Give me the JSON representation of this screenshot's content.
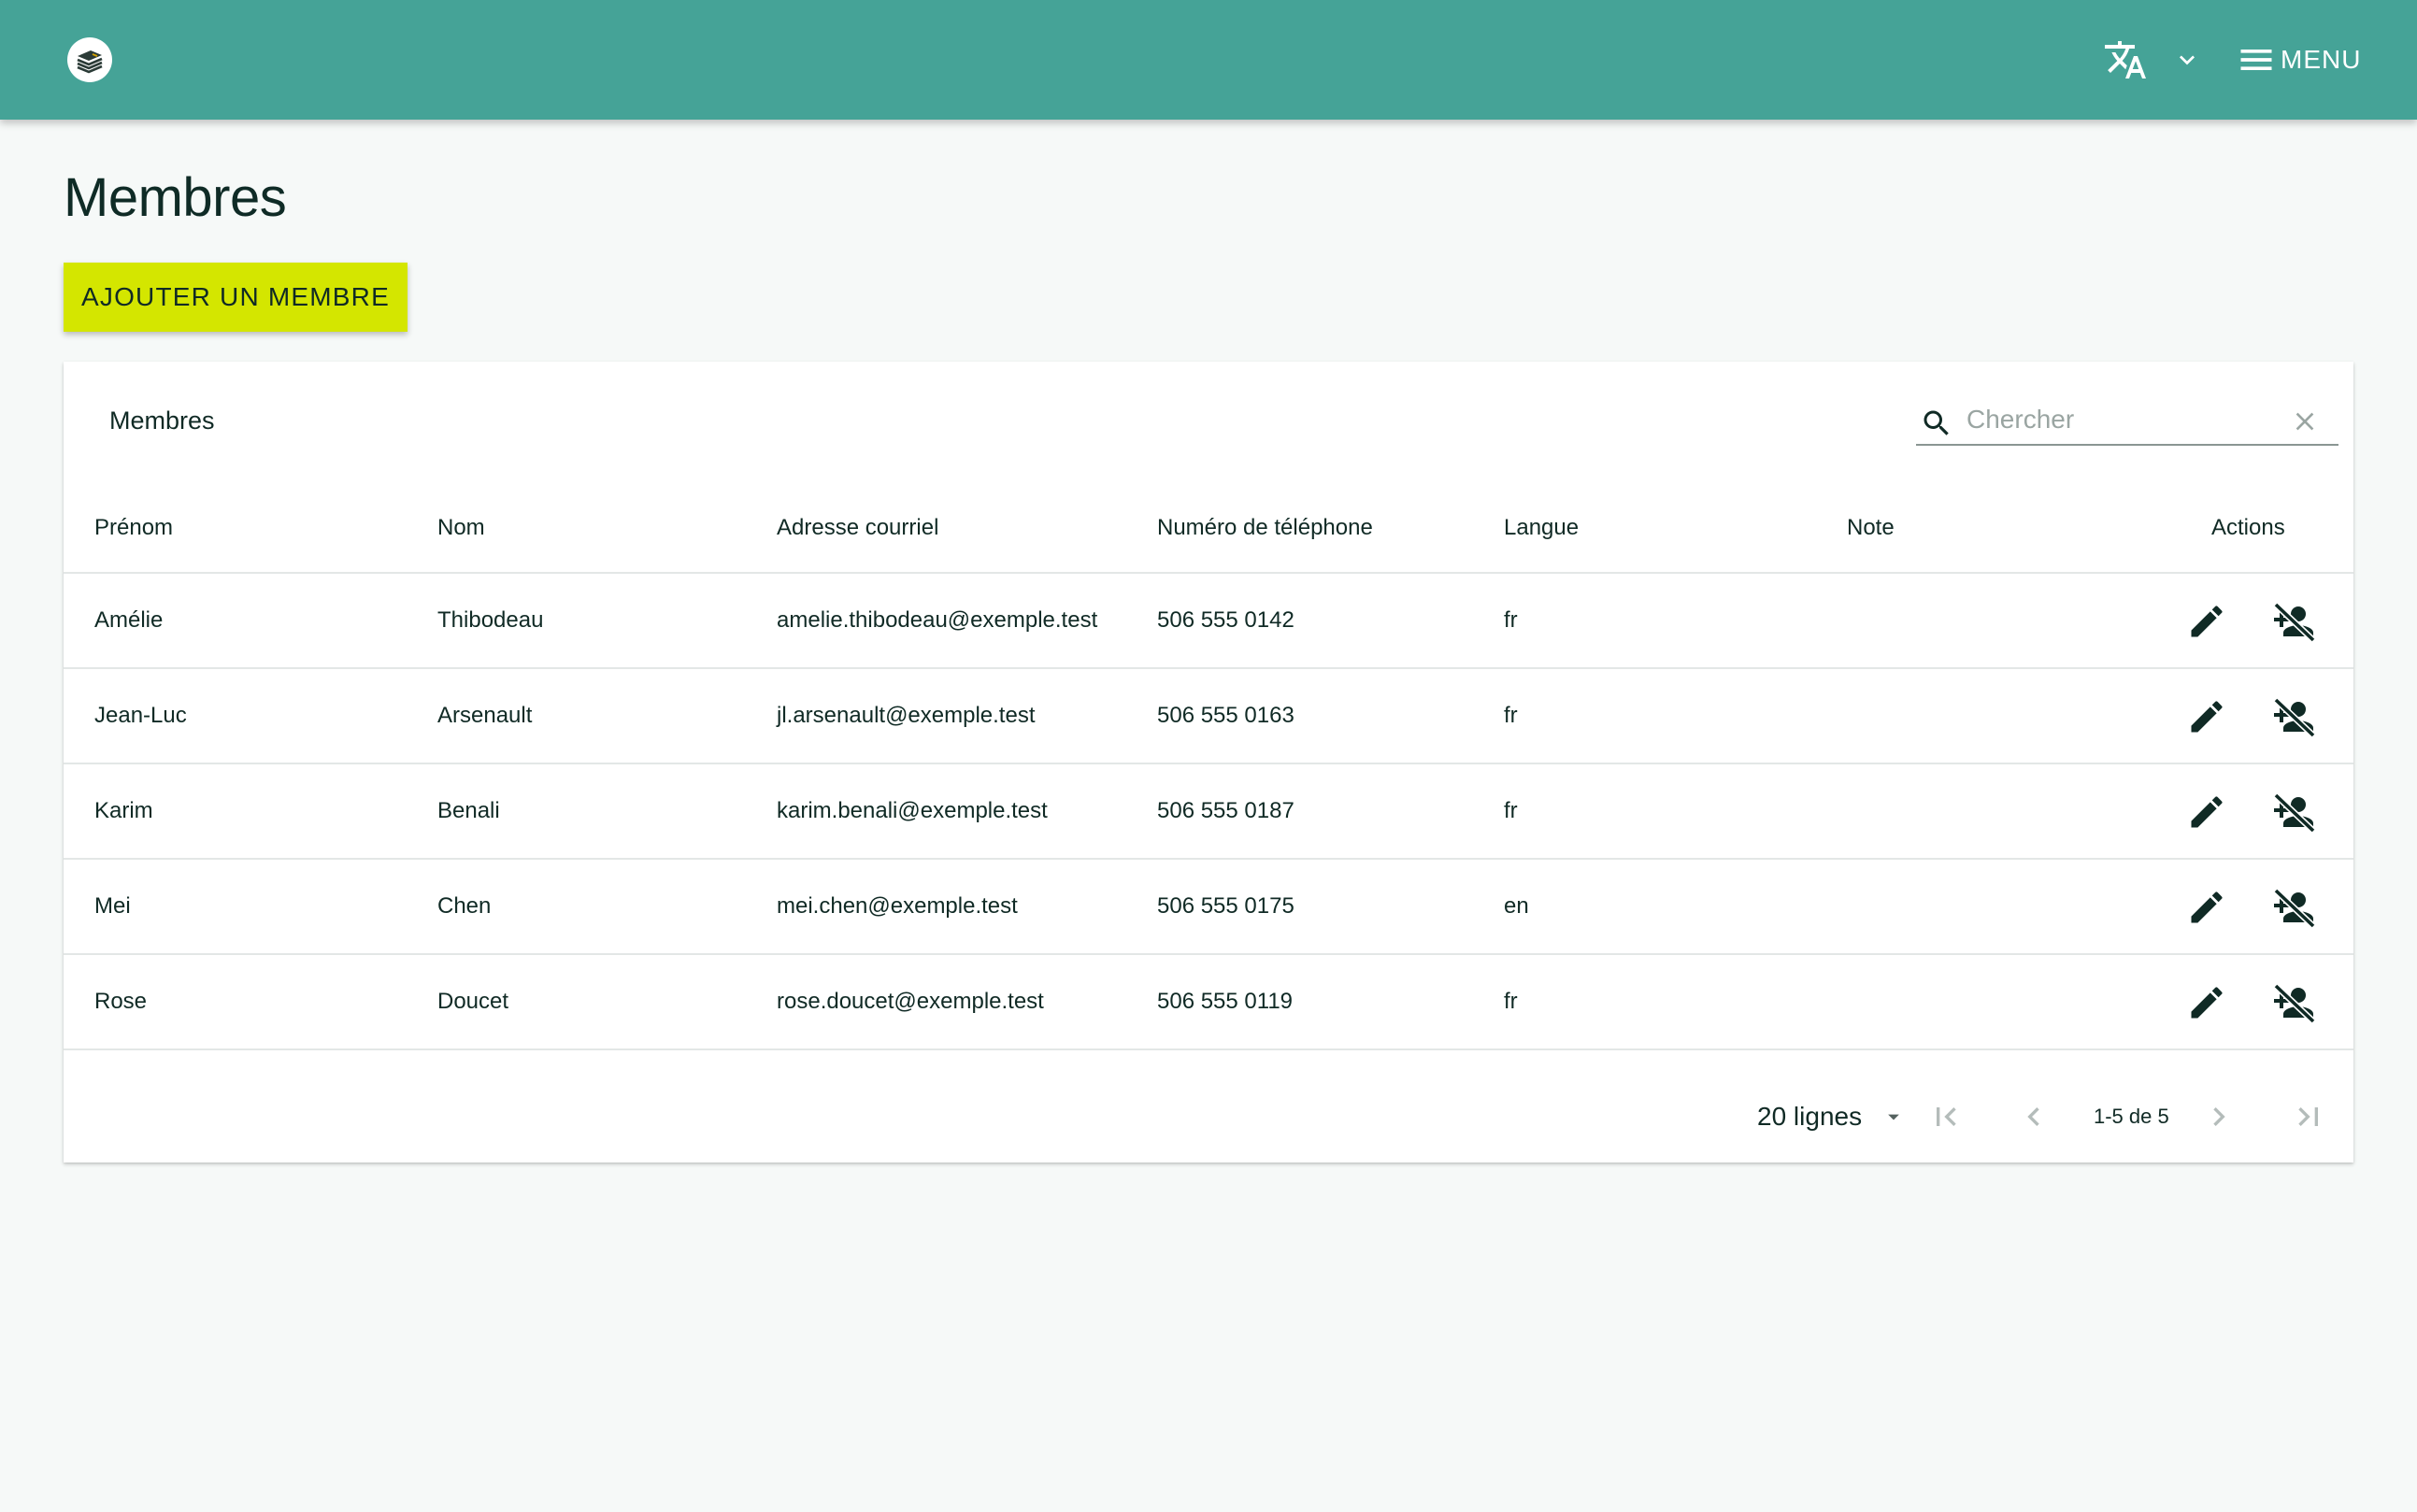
{
  "header": {
    "logo_alt": "logo",
    "menu_label": "MENU",
    "icons": {
      "translate": "translate-icon",
      "chevron": "chevron-down-icon",
      "menu": "hamburger-icon"
    }
  },
  "page": {
    "title": "Membres",
    "add_button_label": "AJOUTER UN MEMBRE"
  },
  "table": {
    "title": "Membres",
    "search_placeholder": "Chercher",
    "columns": [
      "Prénom",
      "Nom",
      "Adresse courriel",
      "Numéro de téléphone",
      "Langue",
      "Note",
      "Actions"
    ],
    "rows": [
      {
        "prenom": "Amélie",
        "nom": "Thibodeau",
        "courriel": "amelie.thibodeau@exemple.test",
        "telephone": "506 555 0142",
        "langue": "fr",
        "note": ""
      },
      {
        "prenom": "Jean-Luc",
        "nom": "Arsenault",
        "courriel": "jl.arsenault@exemple.test",
        "telephone": "506 555 0163",
        "langue": "fr",
        "note": ""
      },
      {
        "prenom": "Karim",
        "nom": "Benali",
        "courriel": "karim.benali@exemple.test",
        "telephone": "506 555 0187",
        "langue": "fr",
        "note": ""
      },
      {
        "prenom": "Mei",
        "nom": "Chen",
        "courriel": "mei.chen@exemple.test",
        "telephone": "506 555 0175",
        "langue": "en",
        "note": ""
      },
      {
        "prenom": "Rose",
        "nom": "Doucet",
        "courriel": "rose.doucet@exemple.test",
        "telephone": "506 555 0119",
        "langue": "fr",
        "note": ""
      }
    ]
  },
  "pagination": {
    "rows_per_page": "20 lignes",
    "range": "1-5 de 5"
  },
  "colors": {
    "appbar": "#45a397",
    "accent_button": "#d4e600",
    "text": "#102a25",
    "background": "#f6f9f8"
  }
}
